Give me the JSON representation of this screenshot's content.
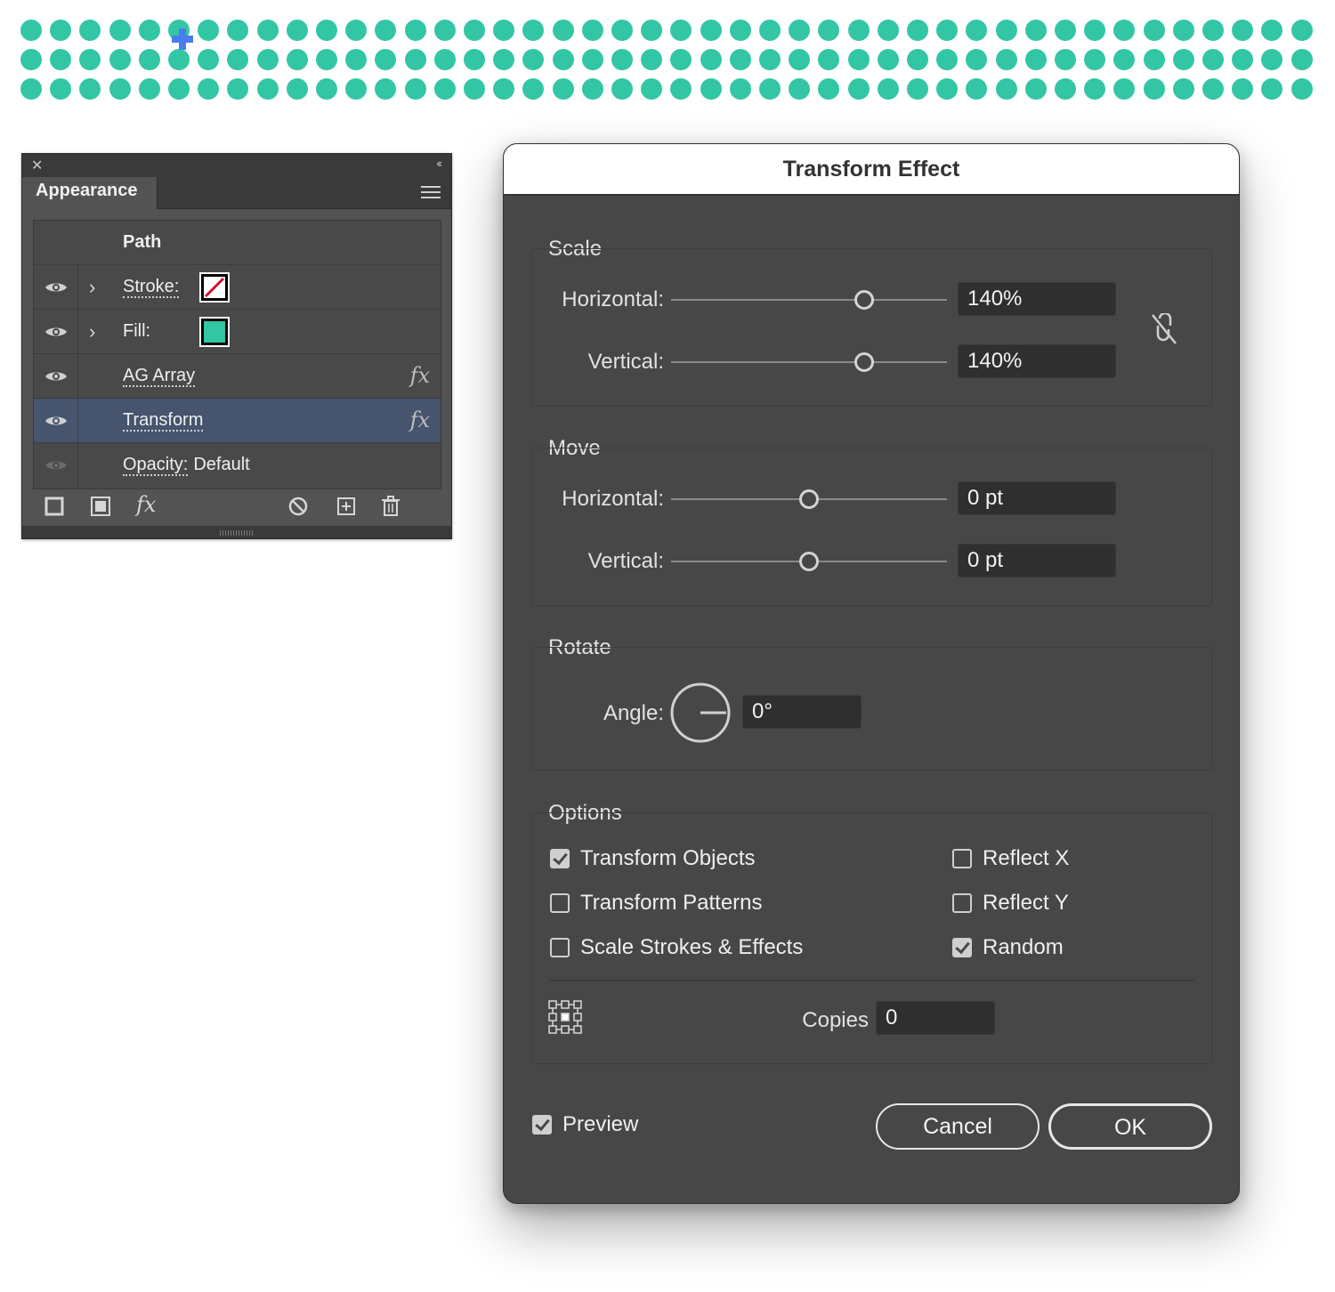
{
  "canvas": {
    "dot_color": "#33c6a5",
    "cursor_color": "#4a7cf0",
    "dot_rows": 3,
    "dot_cols": 44
  },
  "appearance_panel": {
    "close_icon": "close-icon",
    "collapse_icon": "double-chevron-left-icon",
    "tab_label": "Appearance",
    "menu_icon": "hamburger-menu-icon",
    "header": "Path",
    "rows": [
      {
        "label": "Stroke:",
        "swatch": "none-swatch",
        "eye_visible": true,
        "expandable": true
      },
      {
        "label": "Fill:",
        "swatch_color": "#33c6a5",
        "eye_visible": true,
        "expandable": true
      },
      {
        "label": "AG Array",
        "fx": "fx",
        "eye_visible": true
      },
      {
        "label": "Transform",
        "fx": "fx",
        "eye_visible": true,
        "selected": true
      },
      {
        "label": "Opacity:",
        "value": "Default",
        "eye_visible": false
      }
    ],
    "footer_icons": [
      "add-stroke-icon",
      "add-fill-icon",
      "fx-menu-icon",
      "clear-appearance-icon",
      "duplicate-item-icon",
      "trash-icon"
    ],
    "fx_footer_label": "fx"
  },
  "dialog": {
    "title": "Transform Effect",
    "scale": {
      "label": "Scale",
      "horizontal_label": "Horizontal:",
      "horizontal_value": "140%",
      "horizontal_slider_fraction": 0.7,
      "vertical_label": "Vertical:",
      "vertical_value": "140%",
      "vertical_slider_fraction": 0.7,
      "link_icon": "unlink-proportions-icon"
    },
    "move": {
      "label": "Move",
      "horizontal_label": "Horizontal:",
      "horizontal_value": "0 pt",
      "horizontal_slider_fraction": 0.5,
      "vertical_label": "Vertical:",
      "vertical_value": "0 pt",
      "vertical_slider_fraction": 0.5
    },
    "rotate": {
      "label": "Rotate",
      "angle_label": "Angle:",
      "angle_value": "0°"
    },
    "options": {
      "label": "Options",
      "transform_objects": {
        "label": "Transform Objects",
        "checked": true
      },
      "transform_patterns": {
        "label": "Transform Patterns",
        "checked": false
      },
      "scale_strokes": {
        "label": "Scale Strokes & Effects",
        "checked": false
      },
      "reflect_x": {
        "label": "Reflect X",
        "checked": false
      },
      "reflect_y": {
        "label": "Reflect Y",
        "checked": false
      },
      "random": {
        "label": "Random",
        "checked": true
      },
      "reference_point_icon": "reference-point-locator-icon",
      "copies_label": "Copies",
      "copies_value": "0"
    },
    "preview": {
      "label": "Preview",
      "checked": true
    },
    "cancel_label": "Cancel",
    "ok_label": "OK"
  }
}
